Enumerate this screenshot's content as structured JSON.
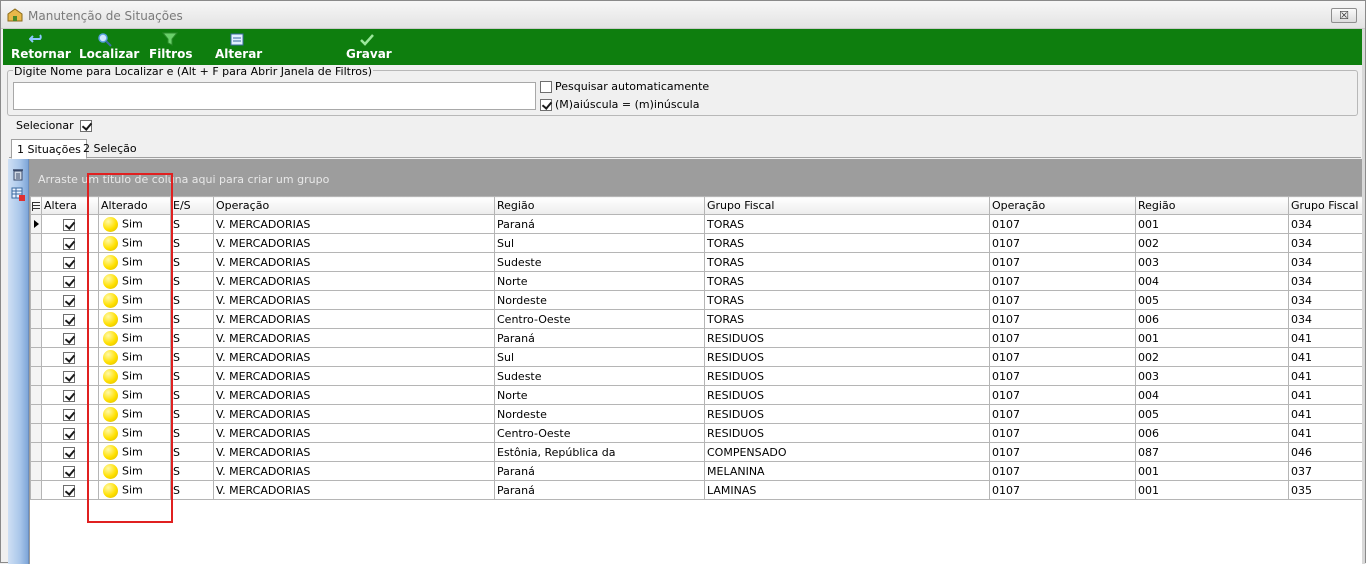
{
  "window": {
    "title": "Manutenção de Situações",
    "close_label": "☒"
  },
  "toolbar": {
    "buttons": [
      {
        "label": "Retornar",
        "icon": "back-arrow-icon"
      },
      {
        "label": "Localizar",
        "icon": "magnifier-icon"
      },
      {
        "label": "Filtros",
        "icon": "funnel-icon"
      },
      {
        "label": "Alterar",
        "icon": "edit-icon"
      },
      {
        "label": "Gravar",
        "icon": "checkmark-icon"
      }
    ],
    "color": "#0e7e0e"
  },
  "search": {
    "legend": "Digite Nome para Localizar e (Alt + F para Abrir Janela de Filtros)",
    "value": "",
    "auto_search_label": "Pesquisar automaticamente",
    "auto_search_checked": false,
    "case_label": "(M)aiúscula = (m)inúscula",
    "case_checked": true
  },
  "select": {
    "label": "Selecionar",
    "checked": true
  },
  "tabs": [
    {
      "label": "1 Situações",
      "active": true
    },
    {
      "label": "2 Seleção",
      "active": false
    }
  ],
  "grid": {
    "group_hint": "Arraste um título de coluna aqui para criar um grupo",
    "columns": [
      "Altera",
      "Alterado",
      "E/S",
      "Operação",
      "Região",
      "Grupo Fiscal",
      "Operação",
      "Região",
      "Grupo Fiscal"
    ],
    "rows": [
      {
        "altera": true,
        "alterado": "Sim",
        "es": "S",
        "operacao": "V. MERCADORIAS",
        "regiao": "Paraná",
        "grupo": "TORAS",
        "op_code": "0107",
        "reg_code": "001",
        "grp_code": "034"
      },
      {
        "altera": true,
        "alterado": "Sim",
        "es": "S",
        "operacao": "V. MERCADORIAS",
        "regiao": "Sul",
        "grupo": "TORAS",
        "op_code": "0107",
        "reg_code": "002",
        "grp_code": "034"
      },
      {
        "altera": true,
        "alterado": "Sim",
        "es": "S",
        "operacao": "V. MERCADORIAS",
        "regiao": "Sudeste",
        "grupo": "TORAS",
        "op_code": "0107",
        "reg_code": "003",
        "grp_code": "034"
      },
      {
        "altera": true,
        "alterado": "Sim",
        "es": "S",
        "operacao": "V. MERCADORIAS",
        "regiao": "Norte",
        "grupo": "TORAS",
        "op_code": "0107",
        "reg_code": "004",
        "grp_code": "034"
      },
      {
        "altera": true,
        "alterado": "Sim",
        "es": "S",
        "operacao": "V. MERCADORIAS",
        "regiao": "Nordeste",
        "grupo": "TORAS",
        "op_code": "0107",
        "reg_code": "005",
        "grp_code": "034"
      },
      {
        "altera": true,
        "alterado": "Sim",
        "es": "S",
        "operacao": "V. MERCADORIAS",
        "regiao": "Centro-Oeste",
        "grupo": "TORAS",
        "op_code": "0107",
        "reg_code": "006",
        "grp_code": "034"
      },
      {
        "altera": true,
        "alterado": "Sim",
        "es": "S",
        "operacao": "V. MERCADORIAS",
        "regiao": "Paraná",
        "grupo": "RESIDUOS",
        "op_code": "0107",
        "reg_code": "001",
        "grp_code": "041"
      },
      {
        "altera": true,
        "alterado": "Sim",
        "es": "S",
        "operacao": "V. MERCADORIAS",
        "regiao": "Sul",
        "grupo": "RESIDUOS",
        "op_code": "0107",
        "reg_code": "002",
        "grp_code": "041"
      },
      {
        "altera": true,
        "alterado": "Sim",
        "es": "S",
        "operacao": "V. MERCADORIAS",
        "regiao": "Sudeste",
        "grupo": "RESIDUOS",
        "op_code": "0107",
        "reg_code": "003",
        "grp_code": "041"
      },
      {
        "altera": true,
        "alterado": "Sim",
        "es": "S",
        "operacao": "V. MERCADORIAS",
        "regiao": "Norte",
        "grupo": "RESIDUOS",
        "op_code": "0107",
        "reg_code": "004",
        "grp_code": "041"
      },
      {
        "altera": true,
        "alterado": "Sim",
        "es": "S",
        "operacao": "V. MERCADORIAS",
        "regiao": "Nordeste",
        "grupo": "RESIDUOS",
        "op_code": "0107",
        "reg_code": "005",
        "grp_code": "041"
      },
      {
        "altera": true,
        "alterado": "Sim",
        "es": "S",
        "operacao": "V. MERCADORIAS",
        "regiao": "Centro-Oeste",
        "grupo": "RESIDUOS",
        "op_code": "0107",
        "reg_code": "006",
        "grp_code": "041"
      },
      {
        "altera": true,
        "alterado": "Sim",
        "es": "S",
        "operacao": "V. MERCADORIAS",
        "regiao": "Estônia, República da",
        "grupo": "COMPENSADO",
        "op_code": "0107",
        "reg_code": "087",
        "grp_code": "046"
      },
      {
        "altera": true,
        "alterado": "Sim",
        "es": "S",
        "operacao": "V. MERCADORIAS",
        "regiao": "Paraná",
        "grupo": "MELANINA",
        "op_code": "0107",
        "reg_code": "001",
        "grp_code": "037"
      },
      {
        "altera": true,
        "alterado": "Sim",
        "es": "S",
        "operacao": "V. MERCADORIAS",
        "regiao": "Paraná",
        "grupo": "LAMINAS",
        "op_code": "0107",
        "reg_code": "001",
        "grp_code": "035"
      }
    ]
  },
  "highlight_color": "#e02020"
}
